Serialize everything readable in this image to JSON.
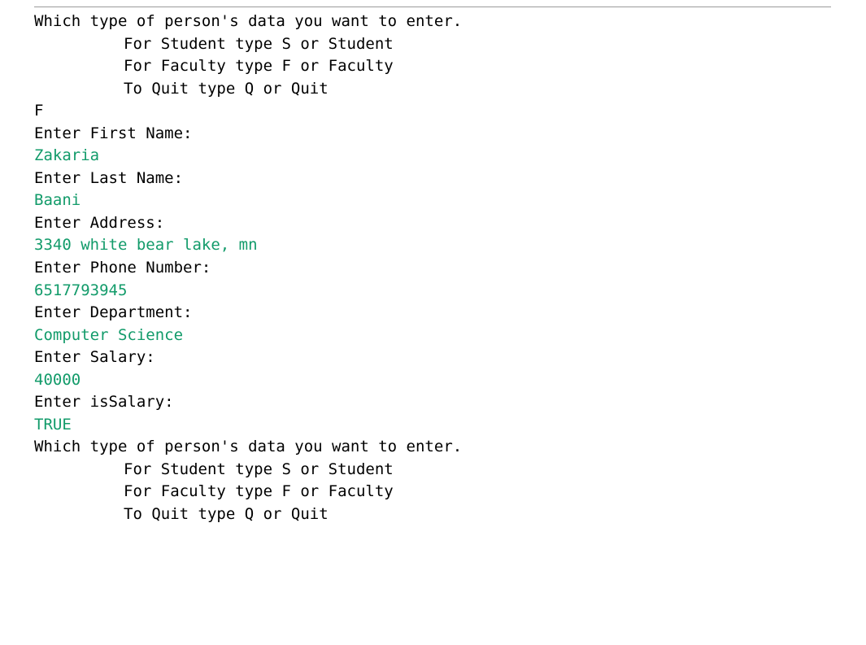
{
  "colors": {
    "prompt": "#000000",
    "input": "#129b6a"
  },
  "block1": {
    "prompt_header": "Which type of person's data you want to enter.",
    "opt_student": "For Student type S or Student",
    "opt_faculty": "For Faculty type F or Faculty",
    "opt_quit": "To Quit type Q or Quit"
  },
  "entries": {
    "choice": "F",
    "first_name_prompt": "Enter First Name:",
    "first_name": "Zakaria",
    "last_name_prompt": "Enter Last Name:",
    "last_name": "Baani",
    "address_prompt": "Enter Address:",
    "address": "3340 white bear lake, mn",
    "phone_prompt": "Enter Phone Number:",
    "phone": "6517793945",
    "department_prompt": "Enter Department:",
    "department": "Computer Science",
    "salary_prompt": "Enter Salary:",
    "salary": "40000",
    "is_salary_prompt": "Enter isSalary:",
    "is_salary": "TRUE"
  },
  "block2": {
    "prompt_header": "Which type of person's data you want to enter.",
    "opt_student": "For Student type S or Student",
    "opt_faculty": "For Faculty type F or Faculty",
    "opt_quit": "To Quit type Q or Quit"
  }
}
